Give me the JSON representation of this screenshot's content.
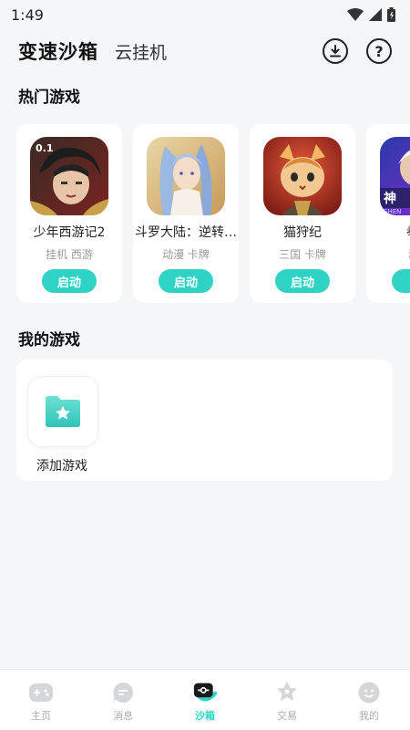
{
  "status_bar": {
    "time": "1:49"
  },
  "header": {
    "title": "变速沙箱",
    "tab": "云挂机",
    "help_glyph": "?"
  },
  "hot_section": {
    "title": "热门游戏",
    "games": [
      {
        "name": "少年西游记2",
        "tags": "挂机 西游",
        "button": "启动",
        "icon": "game-icon-shaonian-xiyouji"
      },
      {
        "name": "斗罗大陆：逆转时空",
        "tags": "动漫 卡牌",
        "button": "启动",
        "icon": "game-icon-douluo-dalu"
      },
      {
        "name": "猫狩纪",
        "tags": "三国 卡牌",
        "button": "启动",
        "icon": "game-icon-maoshouji"
      },
      {
        "name": "拳动",
        "tags": "动漫",
        "button": "启",
        "icon": "game-icon-quandong"
      }
    ]
  },
  "my_section": {
    "title": "我的游戏",
    "add_label": "添加游戏"
  },
  "bottom_nav": {
    "items": [
      {
        "label": "主页",
        "icon": "gamepad-icon",
        "active": false
      },
      {
        "label": "消息",
        "icon": "message-icon",
        "active": false
      },
      {
        "label": "沙箱",
        "icon": "sandbox-icon",
        "active": true
      },
      {
        "label": "交易",
        "icon": "trade-icon",
        "active": false
      },
      {
        "label": "我的",
        "icon": "profile-icon",
        "active": false
      }
    ]
  },
  "colors": {
    "accent": "#2ed3c6",
    "background": "#f5f6f8",
    "card": "#ffffff",
    "muted_text": "#999999"
  }
}
